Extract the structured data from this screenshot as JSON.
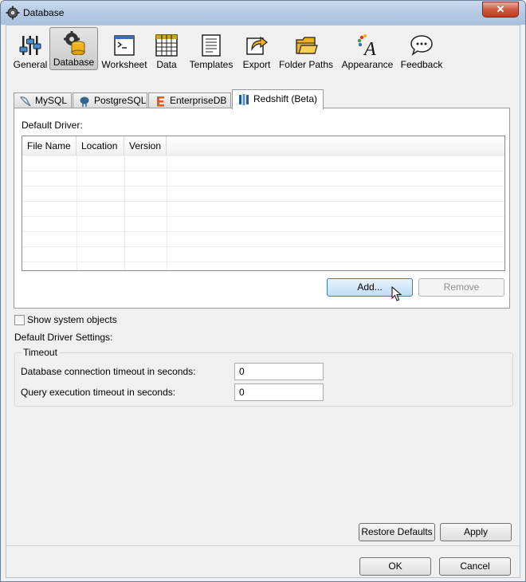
{
  "window": {
    "title": "Database",
    "close_icon": "close-icon"
  },
  "toolbar": {
    "items": [
      {
        "label": "General",
        "icon": "sliders-icon"
      },
      {
        "label": "Database",
        "icon": "database-gear-icon",
        "selected": true
      },
      {
        "label": "Worksheet",
        "icon": "terminal-icon"
      },
      {
        "label": "Data",
        "icon": "grid-icon"
      },
      {
        "label": "Templates",
        "icon": "template-icon"
      },
      {
        "label": "Export",
        "icon": "export-icon"
      },
      {
        "label": "Folder Paths",
        "icon": "folder-icon"
      },
      {
        "label": "Appearance",
        "icon": "appearance-icon"
      },
      {
        "label": "Feedback",
        "icon": "speech-bubble-icon"
      }
    ]
  },
  "tabs": [
    {
      "label": "MySQL",
      "icon": "dolphin-icon"
    },
    {
      "label": "PostgreSQL",
      "icon": "elephant-icon"
    },
    {
      "label": "EnterpriseDB",
      "icon": "edb-icon"
    },
    {
      "label": "Redshift (Beta)",
      "icon": "redshift-icon",
      "selected": true
    }
  ],
  "panel": {
    "default_driver_label": "Default Driver:",
    "columns": [
      "File Name",
      "Location",
      "Version"
    ],
    "rows": [],
    "add_button": "Add...",
    "remove_button": "Remove",
    "remove_enabled": false
  },
  "options": {
    "show_system_objects": "Show system objects",
    "show_system_objects_checked": false,
    "default_driver_settings": "Default Driver Settings:"
  },
  "timeout": {
    "group_title": "Timeout",
    "connection_label": "Database connection timeout in seconds:",
    "connection_value": "0",
    "query_label": "Query execution timeout in seconds:",
    "query_value": "0"
  },
  "buttons": {
    "restore_defaults": "Restore Defaults",
    "apply": "Apply",
    "ok": "OK",
    "cancel": "Cancel"
  },
  "colors": {
    "accent": "#3c7fb1",
    "close": "#c0391d"
  }
}
